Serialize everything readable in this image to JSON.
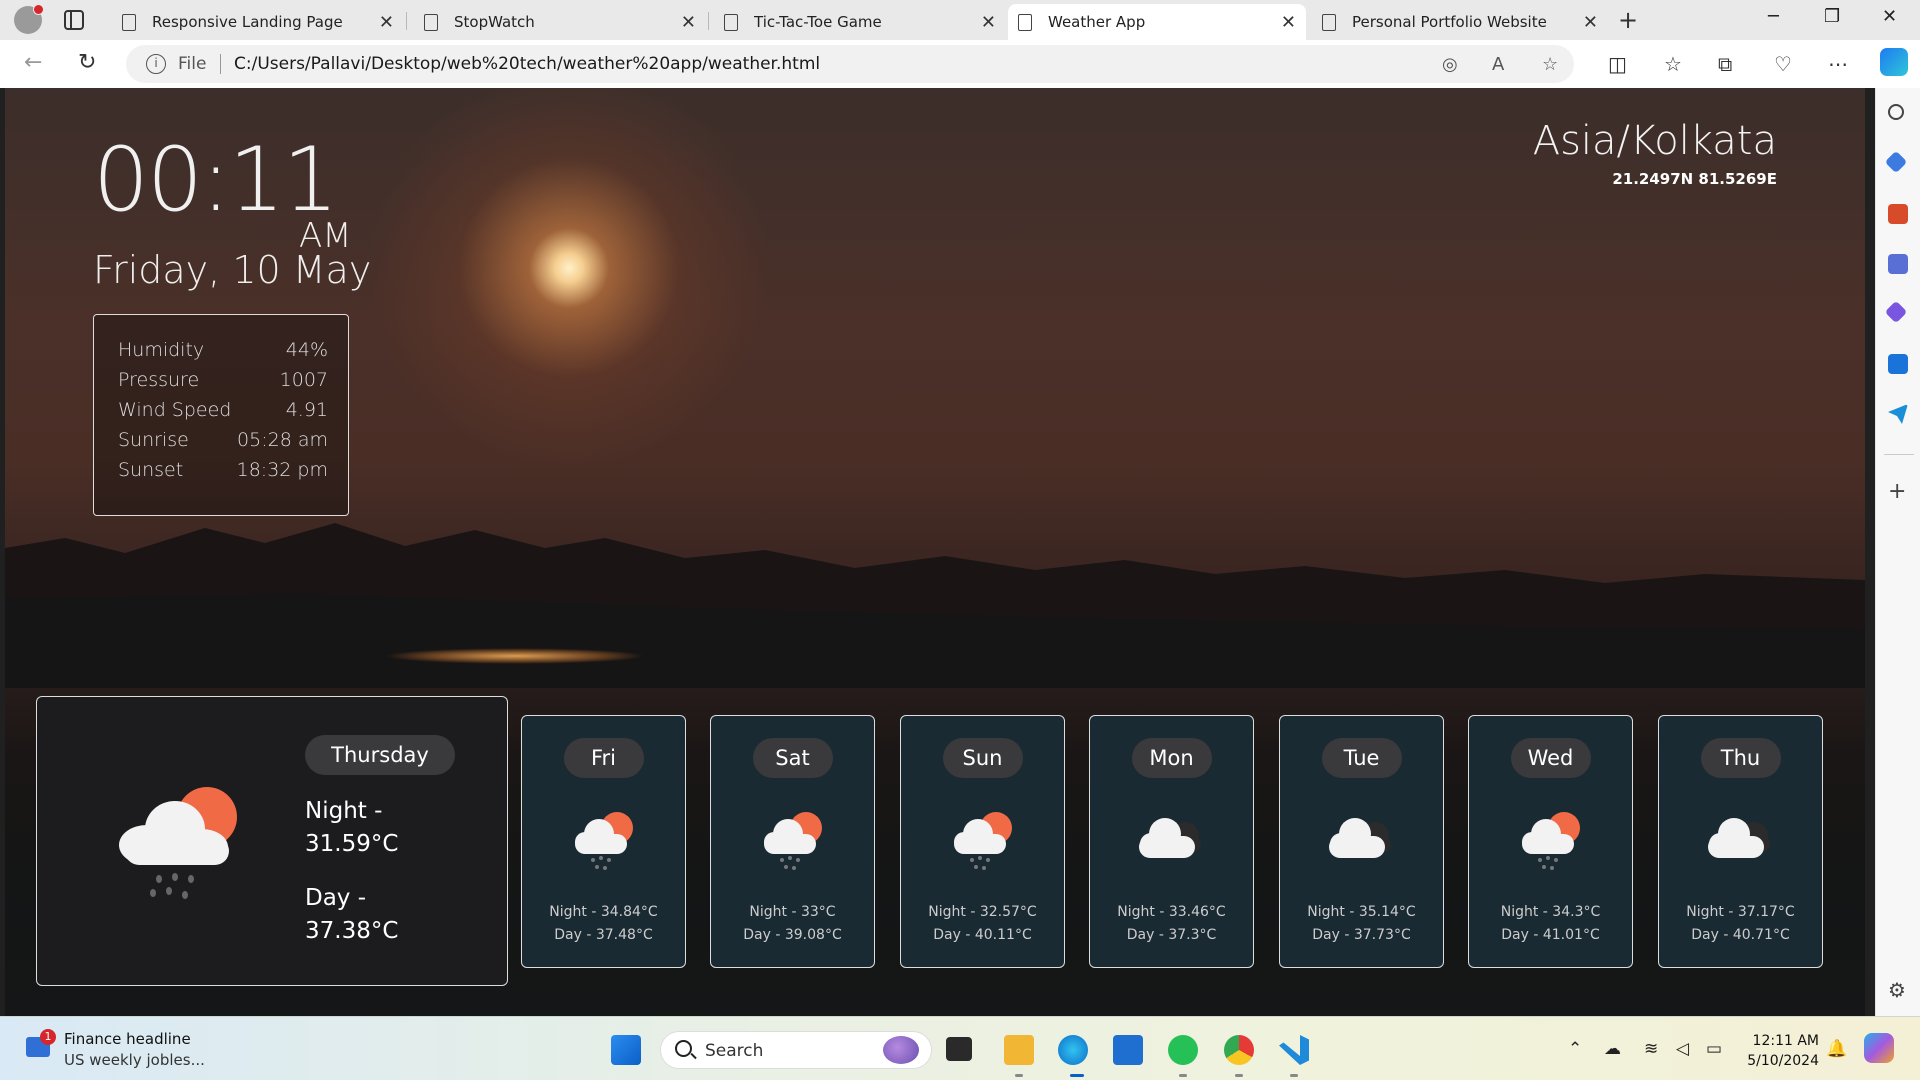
{
  "browser": {
    "tabs": [
      {
        "label": "Responsive Landing Page",
        "active": false
      },
      {
        "label": "StopWatch",
        "active": false
      },
      {
        "label": "Tic-Tac-Toe Game",
        "active": false
      },
      {
        "label": "Weather App",
        "active": true
      },
      {
        "label": "Personal Portfolio Website",
        "active": false
      }
    ],
    "address": {
      "scheme_label": "File",
      "url": "C:/Users/Pallavi/Desktop/web%20tech/weather%20app/weather.html"
    }
  },
  "weather": {
    "time": "00:11",
    "ampm": "AM",
    "date": "Friday, 10 May",
    "timezone": "Asia/Kolkata",
    "coords": "21.2497N 81.5269E",
    "details": [
      {
        "label": "Humidity",
        "value": "44%"
      },
      {
        "label": "Pressure",
        "value": "1007"
      },
      {
        "label": "Wind Speed",
        "value": "4.91"
      },
      {
        "label": "Sunrise",
        "value": "05:28 am"
      },
      {
        "label": "Sunset",
        "value": "18:32 pm"
      }
    ],
    "today": {
      "day": "Thursday",
      "night_label": "Night -",
      "night_value": "31.59°C",
      "day_label": "Day -",
      "day_value": "37.38°C",
      "icon": "sun-cloud-rain-icon"
    },
    "forecast": [
      {
        "day": "Fri",
        "night": "Night - 34.84°C",
        "daytime": "Day - 37.48°C",
        "icon": "sun-cloud-rain-icon"
      },
      {
        "day": "Sat",
        "night": "Night - 33°C",
        "daytime": "Day - 39.08°C",
        "icon": "sun-cloud-rain-icon"
      },
      {
        "day": "Sun",
        "night": "Night - 32.57°C",
        "daytime": "Day - 40.11°C",
        "icon": "sun-cloud-rain-icon"
      },
      {
        "day": "Mon",
        "night": "Night - 33.46°C",
        "daytime": "Day - 37.3°C",
        "icon": "clouds-icon"
      },
      {
        "day": "Tue",
        "night": "Night - 35.14°C",
        "daytime": "Day - 37.73°C",
        "icon": "clouds-icon"
      },
      {
        "day": "Wed",
        "night": "Night - 34.3°C",
        "daytime": "Day - 41.01°C",
        "icon": "sun-cloud-rain-icon"
      },
      {
        "day": "Thu",
        "night": "Night - 37.17°C",
        "daytime": "Day - 40.71°C",
        "icon": "clouds-icon"
      }
    ]
  },
  "taskbar": {
    "news_badge": "1",
    "news_title": "Finance headline",
    "news_sub": "US weekly jobles...",
    "search_placeholder": "Search",
    "clock_time": "12:11 AM",
    "clock_date": "5/10/2024"
  },
  "colors": {
    "accent": "#0a5fc6",
    "sun": "#ef6a45",
    "card_bg": "#1a2a33"
  }
}
